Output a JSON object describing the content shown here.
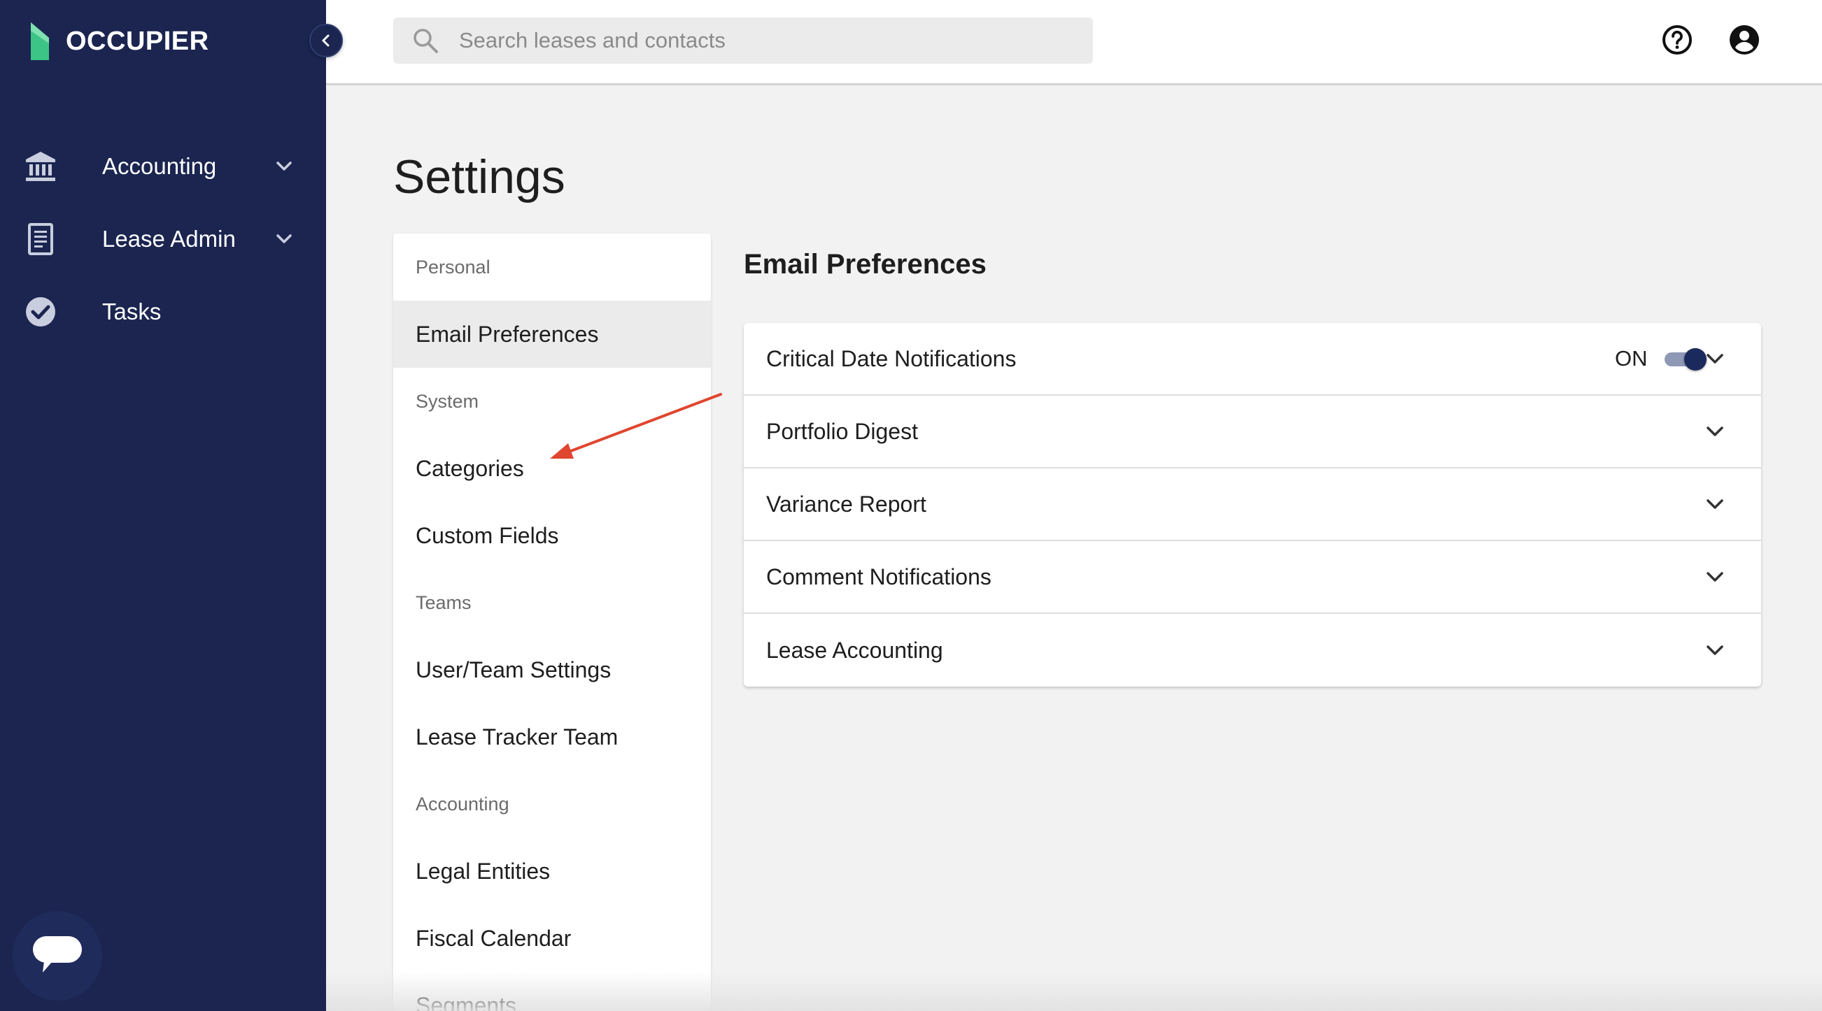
{
  "brand": {
    "name": "OCCUPIER"
  },
  "colors": {
    "sidebar_bg": "#1b2550",
    "brand_green": "#3cc486",
    "toggle_on": "#1b2a5c",
    "annotation_arrow": "#e0452f"
  },
  "sidebar": {
    "items": [
      {
        "label": "Accounting",
        "icon": "bank-icon",
        "has_submenu": true
      },
      {
        "label": "Lease Admin",
        "icon": "document-icon",
        "has_submenu": true
      },
      {
        "label": "Tasks",
        "icon": "check-circle-icon",
        "has_submenu": false
      }
    ],
    "collapse_icon": "chevron-left-icon",
    "chat_icon": "chat-bubble-icon"
  },
  "topbar": {
    "search_placeholder": "Search leases and contacts",
    "help_icon": "help-icon",
    "account_icon": "account-icon"
  },
  "page": {
    "title": "Settings"
  },
  "settings_nav": {
    "personal_header": "Personal",
    "email_preferences": "Email Preferences",
    "system_header": "System",
    "categories": "Categories",
    "custom_fields": "Custom Fields",
    "teams_header": "Teams",
    "user_team_settings": "User/Team Settings",
    "lease_tracker_team": "Lease Tracker Team",
    "accounting_header": "Accounting",
    "legal_entities": "Legal Entities",
    "fiscal_calendar": "Fiscal Calendar",
    "segments": "Segments"
  },
  "email_preferences": {
    "title": "Email Preferences",
    "rows": [
      {
        "label": "Critical Date Notifications",
        "toggle_text": "ON",
        "toggle_on": true
      },
      {
        "label": "Portfolio Digest"
      },
      {
        "label": "Variance Report"
      },
      {
        "label": "Comment Notifications"
      },
      {
        "label": "Lease Accounting"
      }
    ]
  }
}
